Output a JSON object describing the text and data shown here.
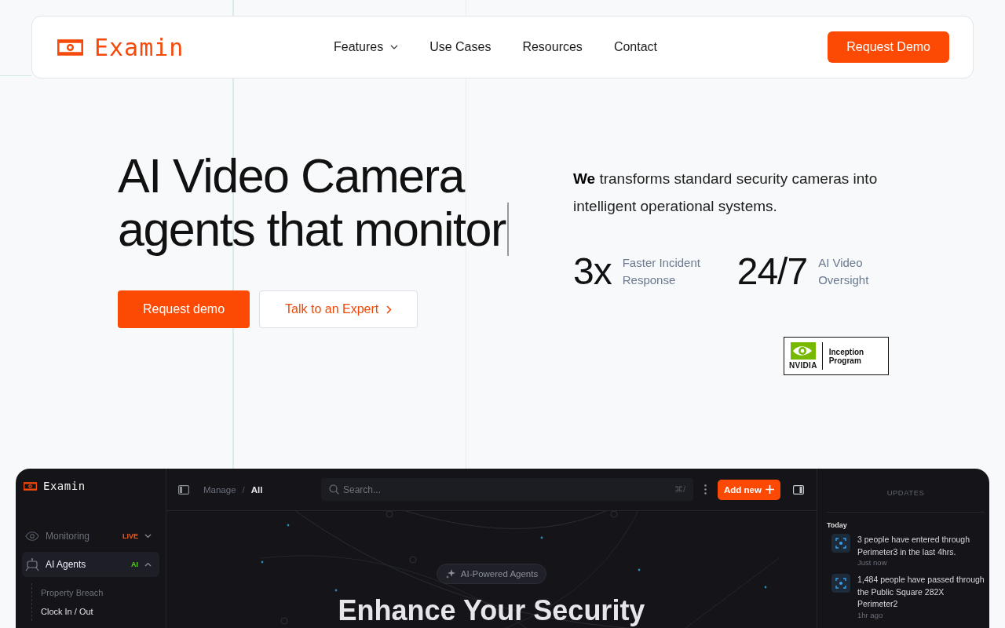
{
  "nav": {
    "brand": "Examin",
    "links": [
      {
        "label": "Features",
        "dropdown": true
      },
      {
        "label": "Use Cases",
        "dropdown": false
      },
      {
        "label": "Resources",
        "dropdown": false
      },
      {
        "label": "Contact",
        "dropdown": false
      }
    ],
    "cta": "Request Demo"
  },
  "hero": {
    "headline": [
      "AI Video Camera",
      "agents that monitor"
    ],
    "typing_cursor": true,
    "buttons": [
      {
        "label": "Request demo",
        "kind": "primary"
      },
      {
        "label": "Talk to an Expert",
        "kind": "secondary"
      }
    ],
    "description": "**We** transforms standard security cameras into intelligent operational systems.",
    "stats": [
      {
        "value": "3x",
        "label": "Faster Incident Response"
      },
      {
        "value": "24/7",
        "label": "AI Video Oversight"
      }
    ],
    "partner_badge": {
      "brand": "NVIDIA",
      "text": "Inception Program"
    }
  },
  "dashboard": {
    "brand": "Examin",
    "sidebar": [
      {
        "label": "Monitoring",
        "badge": "LIVE",
        "color": "#f05a1a",
        "expanded": false,
        "selected": false
      },
      {
        "label": "AI Agents",
        "badge": "AI",
        "color": "#5ad11f",
        "expanded": true,
        "selected": true,
        "children": [
          {
            "label": "Property Breach",
            "selected": false
          },
          {
            "label": "Clock In / Out",
            "selected": true
          }
        ]
      }
    ],
    "breadcrumb": [
      "Manage",
      "All"
    ],
    "breadcrumb_separator": "/",
    "search": {
      "placeholder": "Search...",
      "shortcut": "⌘/"
    },
    "add_button": "Add new",
    "pill": "AI-Powered Agents",
    "heading": "Enhance Your Security",
    "updates": {
      "title": "UPDATES",
      "groups": [
        {
          "label": "Today",
          "items": [
            {
              "text": "3 people have entered through Perimeter3 in the last 4hrs.",
              "time": "Just now"
            },
            {
              "text": "1,484 people have passed through the Public Square 282X Perimeter2",
              "time": "1hr ago"
            }
          ]
        }
      ]
    }
  }
}
